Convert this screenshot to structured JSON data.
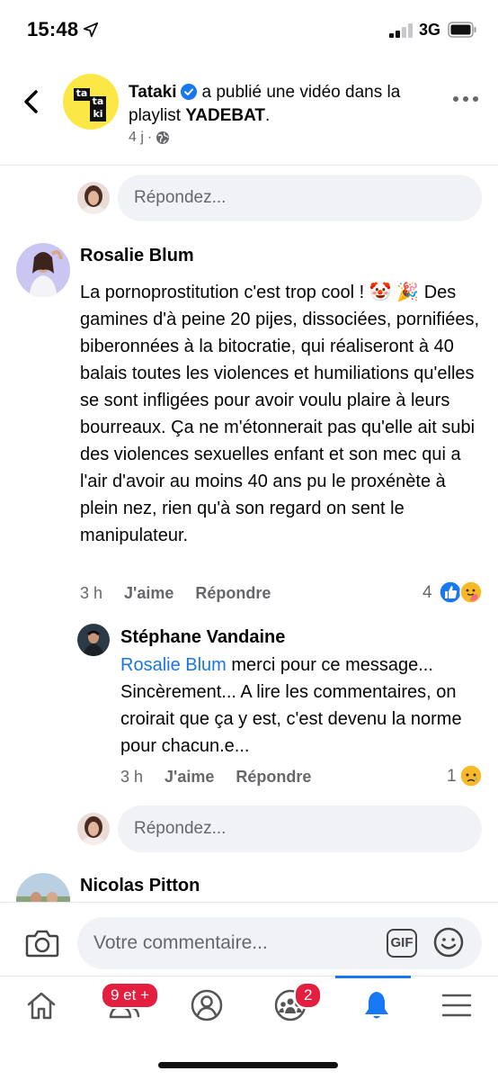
{
  "status_bar": {
    "time": "15:48",
    "network": "3G"
  },
  "post": {
    "page_name": "Tataki",
    "action_text": "a publié une vidéo dans la playlist",
    "playlist": "YADEBAT",
    "period": ".",
    "time_ago": "4 j",
    "dot": "·"
  },
  "reply_placeholder": "Répondez...",
  "comments": [
    {
      "author": "Rosalie Blum",
      "text": "La pornoprostitution c'est trop cool ! 🤡 🎉 Des gamines d'à peine 20 pijes, dissociées, pornifiées, biberonnées à la bitocratie, qui réaliseront à 40 balais toutes les violences et humiliations qu'elles se sont infligées pour avoir voulu plaire à leurs bourreaux. Ça ne m'étonnerait pas qu'elle ait subi des violences sexuelles enfant et son mec qui a l'air d'avoir au moins 40 ans pu le proxénète à plein nez, rien qu'à son regard on sent le manipulateur.",
      "time": "3 h",
      "like": "J'aime",
      "reply": "Répondre",
      "reaction_count": "4",
      "reaction_icons": [
        "like-icon",
        "care-icon"
      ]
    },
    {
      "author": "Stéphane Vandaine",
      "mention": "Rosalie Blum",
      "text": " merci pour ce message... Sincèrement... A lire les commentaires, on croirait que ça y est, c'est devenu la norme pour chacun.e...",
      "time": "3 h",
      "like": "J'aime",
      "reply": "Répondre",
      "reaction_count": "1",
      "reaction_icons": [
        "sad-icon"
      ]
    },
    {
      "author": "Nicolas Pitton"
    }
  ],
  "composer": {
    "placeholder": "Votre commentaire...",
    "gif_label": "GIF"
  },
  "tabs": [
    {
      "name": "home",
      "badge": ""
    },
    {
      "name": "friends",
      "badge": "9 et +"
    },
    {
      "name": "profile",
      "badge": ""
    },
    {
      "name": "groups",
      "badge": "2"
    },
    {
      "name": "notifications",
      "badge": "",
      "active": true
    },
    {
      "name": "menu",
      "badge": ""
    }
  ],
  "colors": {
    "accent": "#1877f2",
    "badge": "#e41e3f",
    "mention": "#1b74e4",
    "input_bg": "#f0f2f5",
    "muted": "#65676b"
  }
}
